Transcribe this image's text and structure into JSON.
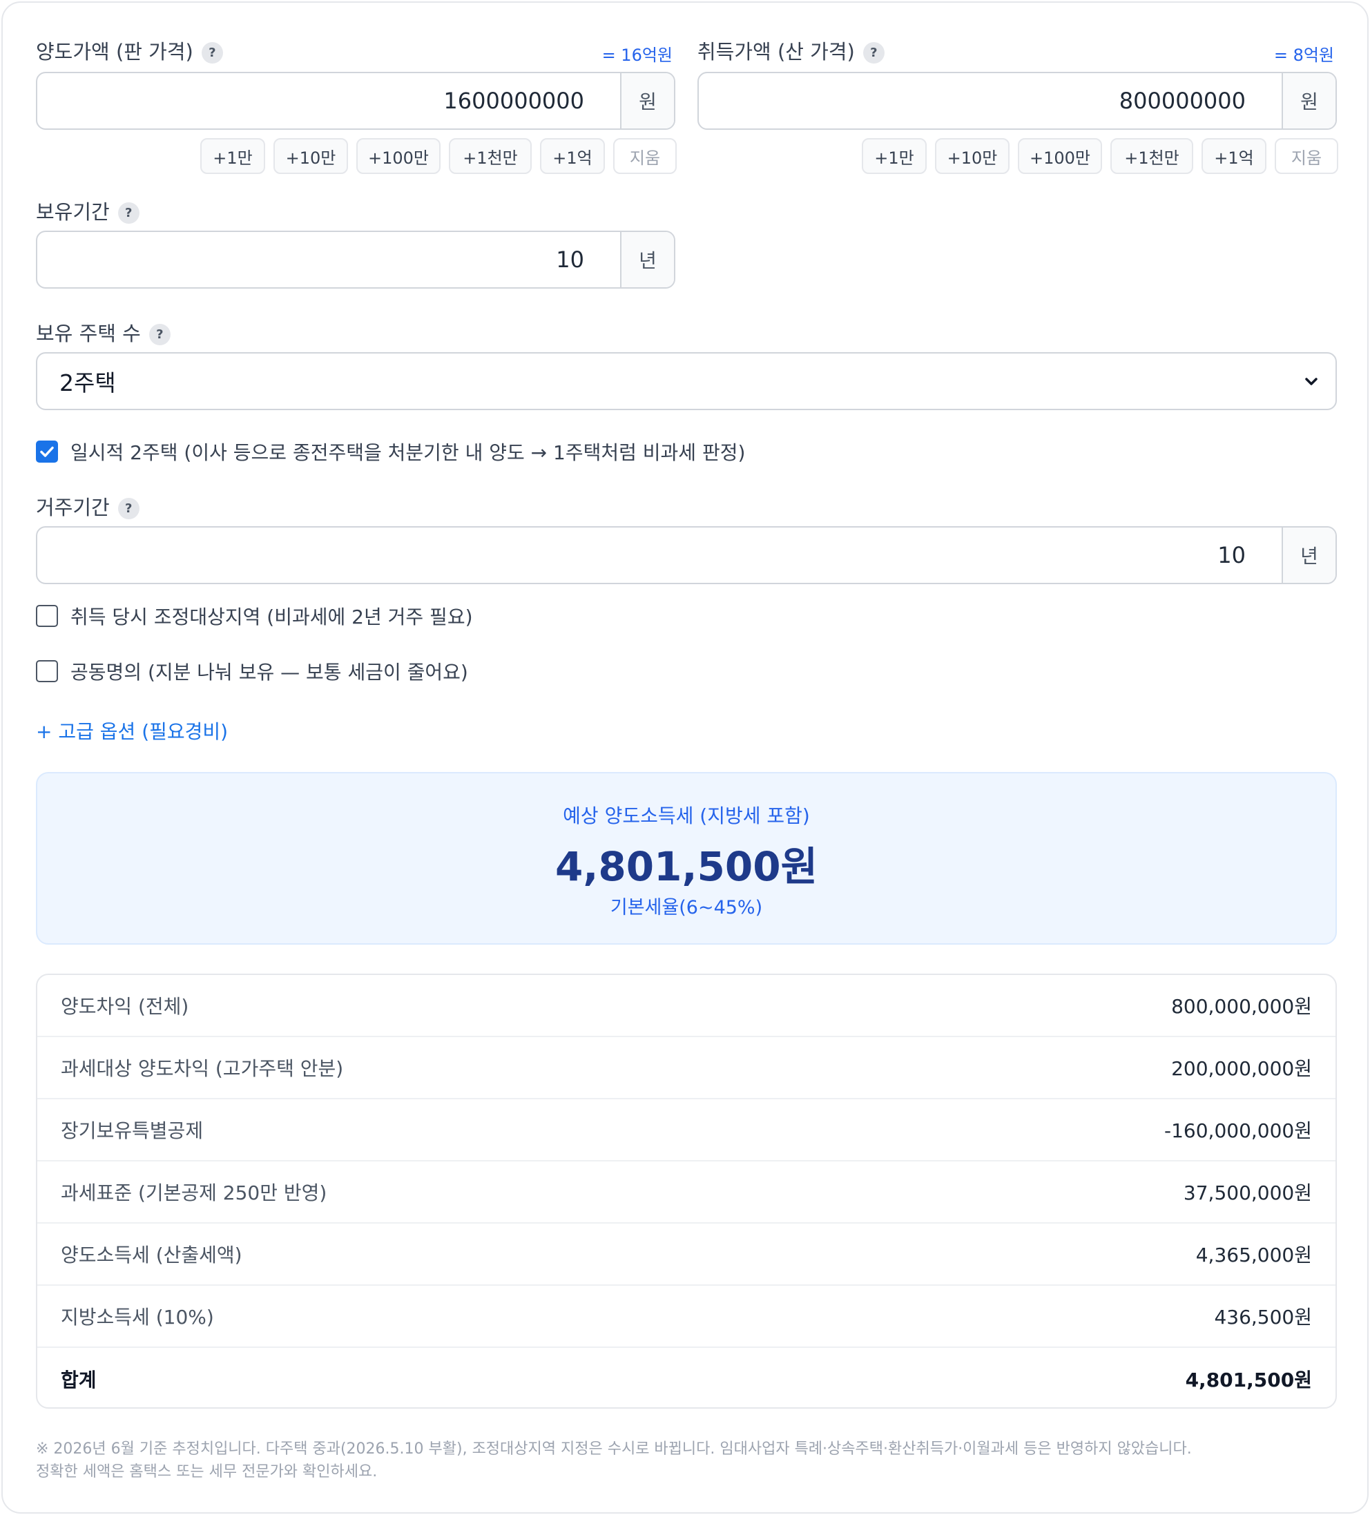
{
  "sale_price": {
    "label": "양도가액 (판 가격)",
    "equiv": "= 16억원",
    "value": "1600000000",
    "unit": "원",
    "buttons": [
      "+1만",
      "+10만",
      "+100만",
      "+1천만",
      "+1억"
    ],
    "clear_label": "지움"
  },
  "acquisition_price": {
    "label": "취득가액 (산 가격)",
    "equiv": "= 8억원",
    "value": "800000000",
    "unit": "원",
    "buttons": [
      "+1만",
      "+10만",
      "+100만",
      "+1천만",
      "+1억"
    ],
    "clear_label": "지움"
  },
  "holding_period": {
    "label": "보유기간",
    "value": "10",
    "unit": "년"
  },
  "house_count": {
    "label": "보유 주택 수",
    "selected": "2주택"
  },
  "temporary_two_house": {
    "label": "일시적 2주택 (이사 등으로 종전주택을 처분기한 내 양도 → 1주택처럼 비과세 판정)",
    "checked": true
  },
  "residence_period": {
    "label": "거주기간",
    "value": "10",
    "unit": "년"
  },
  "adjusted_area": {
    "label": "취득 당시 조정대상지역 (비과세에 2년 거주 필요)",
    "checked": false
  },
  "joint_ownership": {
    "label": "공동명의 (지분 나눠 보유 — 보통 세금이 줄어요)",
    "checked": false
  },
  "advanced_toggle": "+ 고급 옵션 (필요경비)",
  "result": {
    "label": "예상 양도소득세 (지방세 포함)",
    "amount": "4,801,500원",
    "rate_note": "기본세율(6~45%)"
  },
  "breakdown": [
    {
      "label": "양도차익 (전체)",
      "value": "800,000,000원"
    },
    {
      "label": "과세대상 양도차익 (고가주택 안분)",
      "value": "200,000,000원"
    },
    {
      "label": "장기보유특별공제",
      "value": "-160,000,000원"
    },
    {
      "label": "과세표준 (기본공제 250만 반영)",
      "value": "37,500,000원"
    },
    {
      "label": "양도소득세 (산출세액)",
      "value": "4,365,000원"
    },
    {
      "label": "지방소득세 (10%)",
      "value": "436,500원"
    },
    {
      "label": "합계",
      "value": "4,801,500원"
    }
  ],
  "disclaimer_line1": "※ 2026년 6월 기준 추정치입니다. 다주택 중과(2026.5.10 부활), 조정대상지역 지정은 수시로 바뀝니다. 임대사업자 특례·상속주택·환산취득가·이월과세 등은 반영하지 않았습니다.",
  "disclaimer_line2": "정확한 세액은 홈택스 또는 세무 전문가와 확인하세요.",
  "colors": {
    "accent": "#1a73e8",
    "result_bg": "#eff6ff",
    "result_amount": "#1e3a8a",
    "border": "#e5e7eb"
  },
  "icons": {
    "help": "help-icon",
    "checkbox_checked": "check-icon",
    "dropdown": "chevron-down-icon"
  }
}
